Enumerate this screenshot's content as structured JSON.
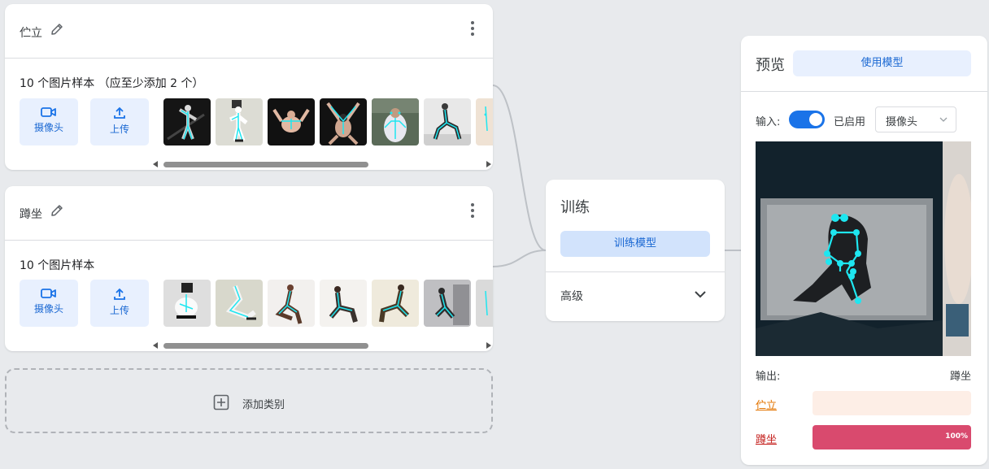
{
  "classes": [
    {
      "name": "伫立",
      "sample_text": "10 个图片样本  （应至少添加 2 个）",
      "webcam_label": "摄像头",
      "upload_label": "上传"
    },
    {
      "name": "蹲坐",
      "sample_text": "10 个图片样本",
      "webcam_label": "摄像头",
      "upload_label": "上传"
    }
  ],
  "add_class_label": "添加类别",
  "training": {
    "title": "训练",
    "train_button": "训练模型",
    "advanced_label": "高级"
  },
  "preview": {
    "title": "预览",
    "export_button": "使用模型",
    "input_label": "输入:",
    "toggle_on": true,
    "enabled_label": "已启用",
    "source_value": "摄像头",
    "output_label": "输出:",
    "output_value": "蹲坐",
    "confidences": [
      {
        "name": "伫立",
        "percent": 0,
        "percent_label": "",
        "color": "#e37400",
        "bar_bg": "#fdeee6",
        "fill": "#f7b48a"
      },
      {
        "name": "蹲坐",
        "percent": 100,
        "percent_label": "100%",
        "color": "#c5221f",
        "bar_bg": "#fbe1e5",
        "fill": "#d94a6e"
      }
    ]
  },
  "colors": {
    "accent": "#1a73e8",
    "pose_cyan": "#1ee6f0"
  }
}
